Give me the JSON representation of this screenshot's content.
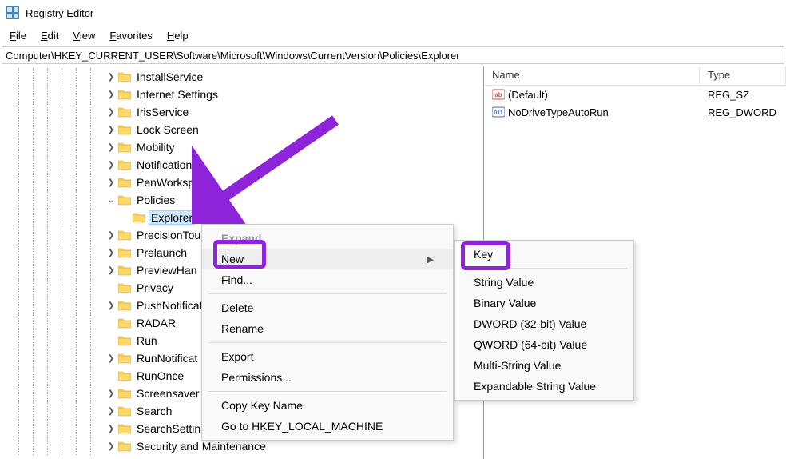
{
  "window": {
    "title": "Registry Editor"
  },
  "menu": {
    "file": "File",
    "edit": "Edit",
    "view": "View",
    "favorites": "Favorites",
    "help": "Help"
  },
  "address": "Computer\\HKEY_CURRENT_USER\\Software\\Microsoft\\Windows\\CurrentVersion\\Policies\\Explorer",
  "tree": {
    "items": [
      {
        "label": "InstallService",
        "exp": ">"
      },
      {
        "label": "Internet Settings",
        "exp": ">"
      },
      {
        "label": "IrisService",
        "exp": ">"
      },
      {
        "label": "Lock Screen",
        "exp": ">"
      },
      {
        "label": "Mobility",
        "exp": ">"
      },
      {
        "label": "Notifications",
        "exp": ">"
      },
      {
        "label": "PenWorkspace",
        "exp": ">"
      },
      {
        "label": "Policies",
        "exp": "v"
      },
      {
        "label": "Explorer",
        "exp": "",
        "child": true,
        "selected": true
      },
      {
        "label": "PrecisionTou",
        "exp": ">"
      },
      {
        "label": "Prelaunch",
        "exp": ">"
      },
      {
        "label": "PreviewHan",
        "exp": ">"
      },
      {
        "label": "Privacy",
        "exp": ""
      },
      {
        "label": "PushNotificat",
        "exp": ">"
      },
      {
        "label": "RADAR",
        "exp": ""
      },
      {
        "label": "Run",
        "exp": ""
      },
      {
        "label": "RunNotificat",
        "exp": ">"
      },
      {
        "label": "RunOnce",
        "exp": ""
      },
      {
        "label": "Screensaver",
        "exp": ">"
      },
      {
        "label": "Search",
        "exp": ">"
      },
      {
        "label": "SearchSettin",
        "exp": ">"
      },
      {
        "label": "Security and Maintenance",
        "exp": ">"
      }
    ]
  },
  "list": {
    "columns": {
      "name": "Name",
      "type": "Type"
    },
    "rows": [
      {
        "name": "(Default)",
        "type": "REG_SZ",
        "icon": "sz"
      },
      {
        "name": "NoDriveTypeAutoRun",
        "type": "REG_DWORD",
        "icon": "dw"
      }
    ]
  },
  "ctx1": {
    "expand": "Expand",
    "new": "New",
    "find": "Find...",
    "delete": "Delete",
    "rename": "Rename",
    "export": "Export",
    "permissions": "Permissions...",
    "copyKey": "Copy Key Name",
    "goto": "Go to HKEY_LOCAL_MACHINE"
  },
  "ctx2": {
    "key": "Key",
    "string": "String Value",
    "binary": "Binary Value",
    "dword": "DWORD (32-bit) Value",
    "qword": "QWORD (64-bit) Value",
    "multi": "Multi-String Value",
    "expandable": "Expandable String Value"
  }
}
